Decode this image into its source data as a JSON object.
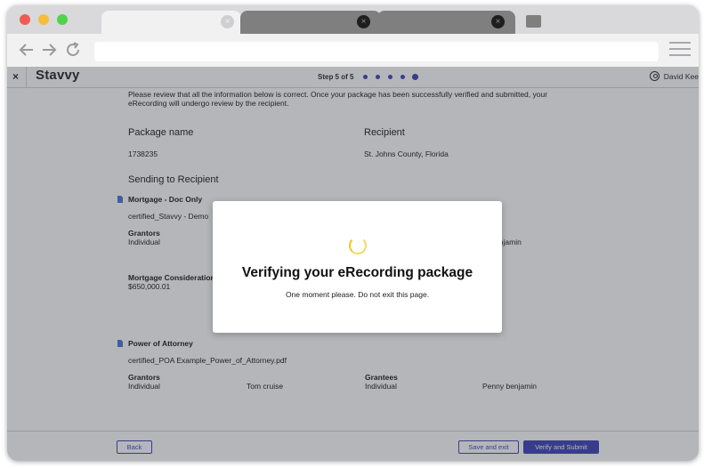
{
  "browser": {
    "tabs": [
      {
        "close_icon": "×"
      },
      {
        "close_icon": "×"
      },
      {
        "close_icon": "×"
      }
    ],
    "url": ""
  },
  "appbar": {
    "close_label": "×",
    "logo": "Stavvy",
    "step_label": "Step 5 of 5",
    "user_name": "David Kee"
  },
  "review": {
    "intro": "Please review that all the information below is correct. Once your package has been successfully verified and submitted, your eRecording will undergo review by the recipient.",
    "package_name_label": "Package name",
    "package_name_value": "1738235",
    "recipient_label": "Recipient",
    "recipient_value": "St. Johns County, Florida",
    "sending_label": "Sending to Recipient",
    "documents": [
      {
        "title": "Mortgage - Doc Only",
        "file": "certified_Stavvy - Demo",
        "grantors_label": "Grantors",
        "grantor_type": "Individual",
        "grantee_partial": "ny benjamin",
        "consideration_label": "Mortgage Consideration",
        "consideration_value": "$650,000.01"
      },
      {
        "title": "Power of Attorney",
        "file": "certified_POA Example_Power_of_Attorney.pdf",
        "grantors_label": "Grantors",
        "grantor_type": "Individual",
        "grantor_name": "Tom cruise",
        "grantees_label": "Grantees",
        "grantee_type": "Individual",
        "grantee_name": "Penny benjamin"
      }
    ]
  },
  "footer": {
    "back": "Back",
    "save_exit": "Save and exit",
    "verify_submit": "Verify and Submit"
  },
  "modal": {
    "title": "Verifying your eRecording package",
    "subtitle": "One moment please. Do not exit this page."
  }
}
